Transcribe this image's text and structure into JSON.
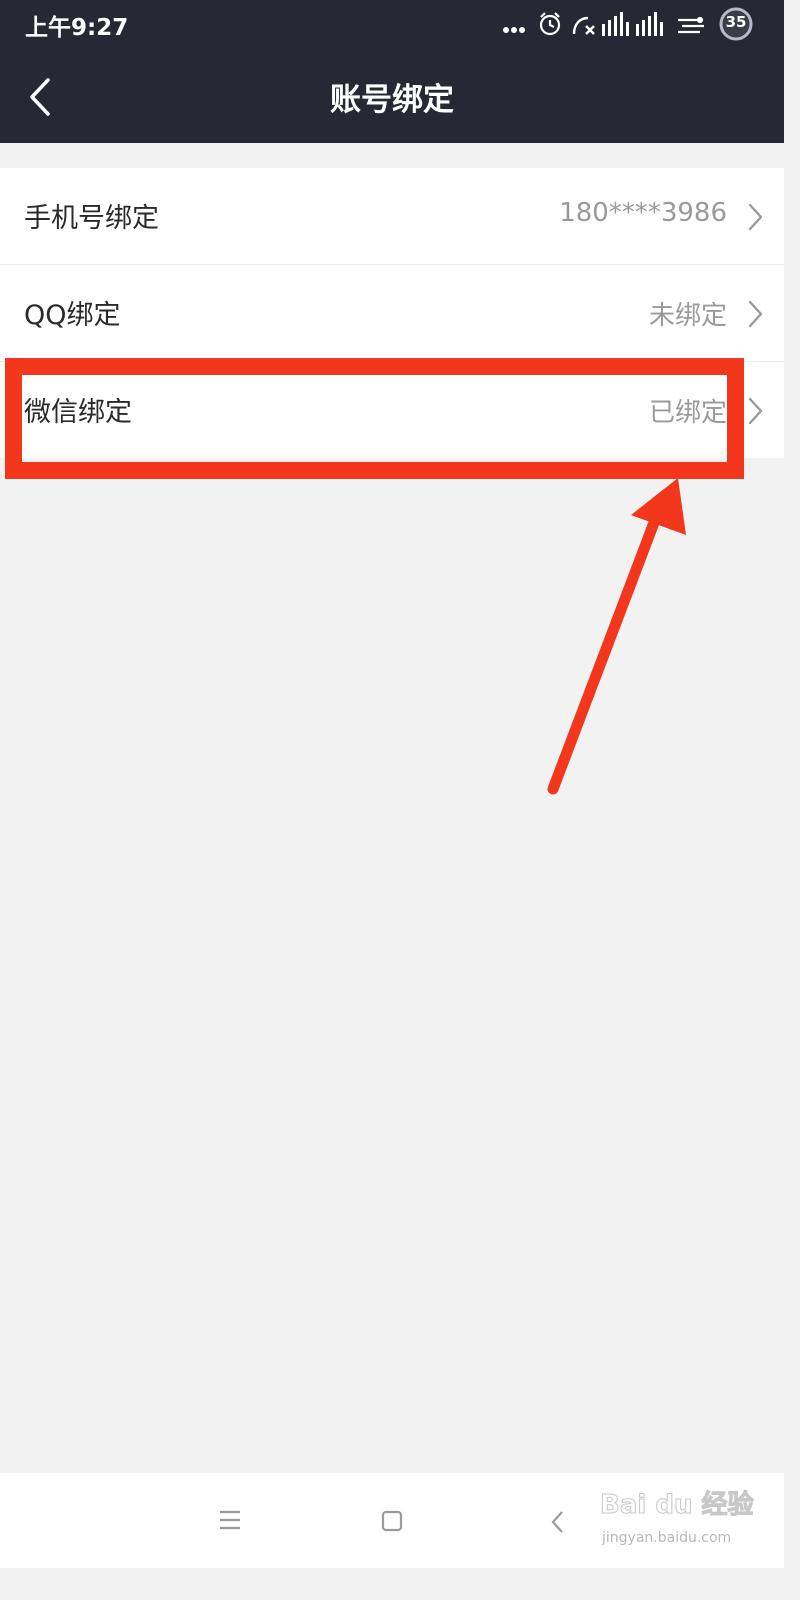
{
  "status_bar": {
    "time": "上午9:27",
    "battery": "35",
    "icons": [
      "more-dots-icon",
      "alarm-icon",
      "call-muted-icon",
      "signal-icon",
      "signal-icon",
      "wifi-icon",
      "battery-icon"
    ]
  },
  "header": {
    "title": "账号绑定",
    "back_icon": "chevron-left-icon"
  },
  "bindings": [
    {
      "label": "手机号绑定",
      "value": "180****3986"
    },
    {
      "label": "QQ绑定",
      "value": "未绑定"
    },
    {
      "label": "微信绑定",
      "value": "已绑定"
    }
  ],
  "annotation": {
    "highlight_color": "#f2371d",
    "target": "微信绑定"
  },
  "nav_bar": {
    "icons": [
      "menu-icon",
      "home-square-icon",
      "back-chevron-icon"
    ]
  },
  "watermark": {
    "brand": "Bai du 经验",
    "url": "jingyan.baidu.com"
  },
  "colors": {
    "header_bg": "#262833",
    "page_bg": "#f3f2f3",
    "row_bg": "#ffffff",
    "value_text": "#9a9a9a"
  }
}
